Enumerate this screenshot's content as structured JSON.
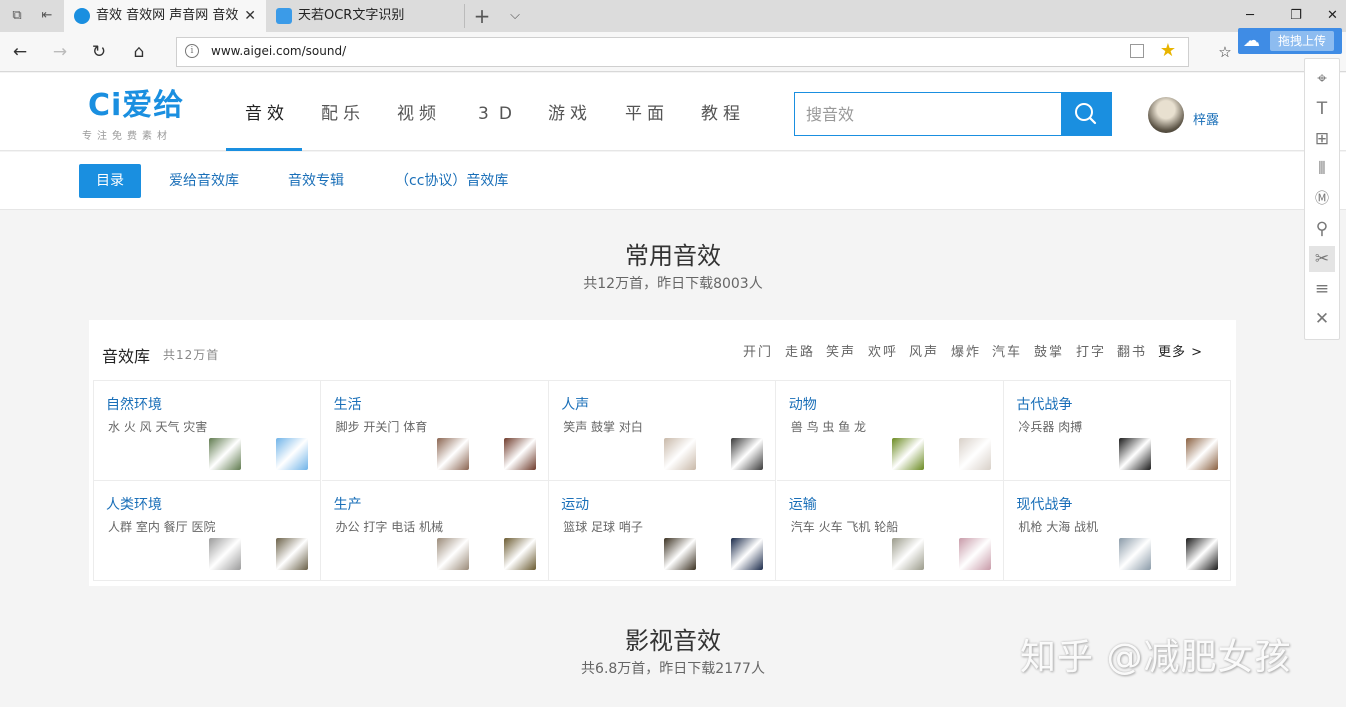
{
  "browser": {
    "tabs": [
      {
        "title": "音效 音效网 声音网 音效",
        "active": true
      },
      {
        "title": "天若OCR文字识别",
        "active": false
      }
    ],
    "new_tab_glyph": "+",
    "tab_list_glyph": "⌵",
    "window": {
      "minimize": "─",
      "restore": "❐",
      "close": "✕"
    },
    "url": "www.aigei.com/sound/",
    "upload_label": "拖拽上传"
  },
  "site": {
    "logo": "Ci爱给",
    "slogan": "专注免费素材",
    "nav": [
      {
        "label": "音效",
        "active": true
      },
      {
        "label": "配乐"
      },
      {
        "label": "视频"
      },
      {
        "label": "3D"
      },
      {
        "label": "游戏"
      },
      {
        "label": "平面"
      },
      {
        "label": "教程"
      }
    ],
    "search_placeholder": "搜音效",
    "username": "梓露"
  },
  "subnav": {
    "directory": "目录",
    "links": [
      "爱给音效库",
      "音效专辑",
      "（cc协议）音效库"
    ]
  },
  "section1": {
    "title": "常用音效",
    "subtitle": "共12万首，昨日下载8003人",
    "library_title": "音效库",
    "library_count": "共12万首",
    "tags": [
      "开门",
      "走路",
      "笑声",
      "欢呼",
      "风声",
      "爆炸",
      "汽车",
      "鼓掌",
      "打字",
      "翻书"
    ],
    "more": "更多 >",
    "categories": [
      {
        "name": "自然环境",
        "desc": "水 火 风 天气 灾害",
        "thumb_colors": [
          "#5f7a4e",
          "#6fb3e8"
        ]
      },
      {
        "name": "生活",
        "desc": "脚步 开关门 体育",
        "thumb_colors": [
          "#8a6450",
          "#6e3a2a"
        ]
      },
      {
        "name": "人声",
        "desc": "笑声 鼓掌 对白",
        "thumb_colors": [
          "#c8b8a8",
          "#3a3a3a"
        ]
      },
      {
        "name": "动物",
        "desc": "兽 鸟 虫 鱼 龙",
        "thumb_colors": [
          "#6a8a20",
          "#d8d0c8"
        ]
      },
      {
        "name": "古代战争",
        "desc": "冷兵器 肉搏",
        "thumb_colors": [
          "#1a1a1a",
          "#8a6040"
        ]
      },
      {
        "name": "人类环境",
        "desc": "人群 室内 餐厅 医院",
        "thumb_colors": [
          "#9a9a9a",
          "#6a6048"
        ]
      },
      {
        "name": "生产",
        "desc": "办公 打字 电话 机械",
        "thumb_colors": [
          "#9a8a78",
          "#6a5a30"
        ]
      },
      {
        "name": "运动",
        "desc": "篮球 足球 哨子",
        "thumb_colors": [
          "#3a3020",
          "#1a2a4a"
        ]
      },
      {
        "name": "运输",
        "desc": "汽车 火车 飞机 轮船",
        "thumb_colors": [
          "#9a9a8a",
          "#c89aa8"
        ]
      },
      {
        "name": "现代战争",
        "desc": "机枪 大海 战机",
        "thumb_colors": [
          "#8a9aa8",
          "#1a1a1a"
        ]
      }
    ]
  },
  "section2": {
    "title": "影视音效",
    "subtitle": "共6.8万首，昨日下载2177人"
  },
  "watermark": "知乎 @减肥女孩",
  "icons": {
    "back": "back-icon",
    "forward": "forward-icon",
    "refresh": "refresh-icon",
    "home": "home-icon",
    "info": "info-icon",
    "reading": "reading-view-icon",
    "favorite": "star-icon",
    "search": "search-icon",
    "cloud": "cloud-icon"
  },
  "colors": {
    "brand": "#1a8fe0",
    "link": "#1a6fb8",
    "upload": "#3f8ce5"
  }
}
